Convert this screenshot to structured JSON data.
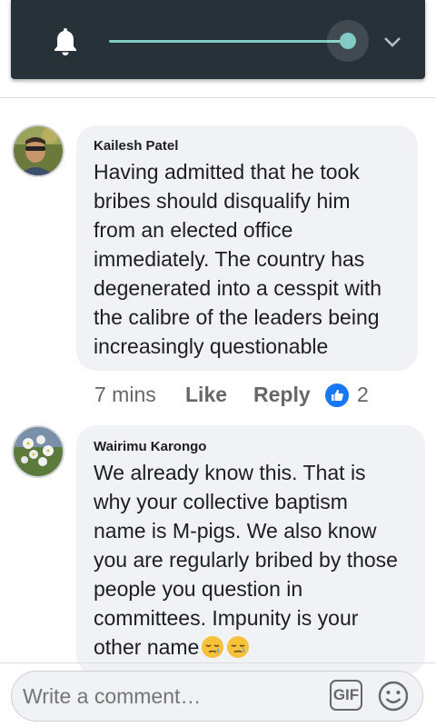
{
  "volume": {
    "level": 0.97,
    "icon": "bell-icon",
    "expand_icon": "chevron-down-icon",
    "accent_color": "#80cbc4",
    "panel_color": "#263238"
  },
  "comments": [
    {
      "author": "Kailesh Patel",
      "lines": [
        "Having admitted that he took",
        "bribes should disqualify him",
        "from an elected office",
        "immediately. The country has",
        "degenerated into a cesspit with",
        "the calibre of the leaders being",
        "increasingly questionable"
      ],
      "time": "7 mins",
      "like_label": "Like",
      "reply_label": "Reply",
      "reaction_count": "2",
      "reaction_icon": "like-reaction-icon"
    },
    {
      "author": "Wairimu Karongo",
      "lines": [
        "We already know this. That is",
        "why your collective baptism",
        "name is M-pigs. We also know",
        "you are regularly bribed by those",
        "people you question in",
        "committees. Impunity is your",
        "other name"
      ],
      "emojis": [
        "sleepy-face-emoji",
        "sleepy-face-emoji"
      ]
    }
  ],
  "composer": {
    "placeholder": "Write a comment…",
    "gif_label": "GIF",
    "emoji_icon": "smiley-icon"
  }
}
